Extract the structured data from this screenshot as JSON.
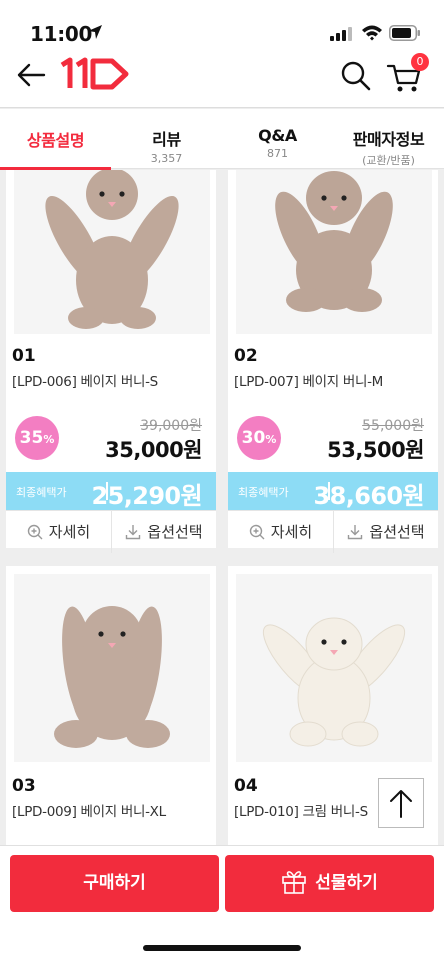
{
  "status_bar": {
    "time": "11:00"
  },
  "nav": {
    "logo_text": "11st",
    "cart_count": "0"
  },
  "tabs": [
    {
      "label": "상품설명",
      "sub": ""
    },
    {
      "label": "리뷰",
      "sub": "3,357"
    },
    {
      "label": "Q&A",
      "sub": "871"
    },
    {
      "label": "판매자정보",
      "sub": "(교환/반품)"
    }
  ],
  "products": [
    {
      "no": "01",
      "name": "[LPD-006] 베이지 버니-S",
      "discount": "35",
      "discount_unit": "%",
      "original_price": "39,000원",
      "sale_price": "35,000원",
      "benefit_label": "최종혜택가",
      "benefit_price": "25,290원",
      "color": "#bfa89a"
    },
    {
      "no": "02",
      "name": "[LPD-007] 베이지 버니-M",
      "discount": "30",
      "discount_unit": "%",
      "original_price": "55,000원",
      "sale_price": "53,500원",
      "benefit_label": "최종혜택가",
      "benefit_price": "38,660원",
      "color": "#bca597"
    },
    {
      "no": "03",
      "name": "[LPD-009] 베이지 버니-XL",
      "color": "#c0aa9d"
    },
    {
      "no": "04",
      "name": "[LPD-010] 크림 버니-S",
      "color": "#f4efe6"
    }
  ],
  "actions": {
    "detail_label": "자세히",
    "option_label": "옵션선택"
  },
  "bottom": {
    "buy_label": "구매하기",
    "gift_label": "선물하기"
  },
  "colors": {
    "accent": "#f22c3d",
    "benefit_bar": "#8ddcf5",
    "discount_badge": "#f37ec2"
  }
}
